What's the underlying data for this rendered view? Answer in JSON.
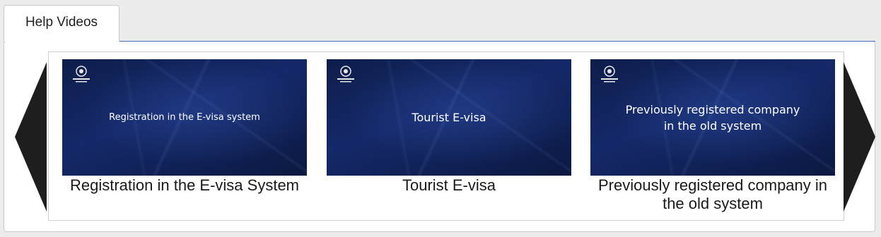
{
  "tabs": [
    {
      "label": "Help Videos",
      "active": true
    }
  ],
  "carousel": {
    "items": [
      {
        "thumbnail_text": "Registration in the E-visa system",
        "caption": "Registration in the E-visa System"
      },
      {
        "thumbnail_text": "Tourist E-visa",
        "caption": "Tourist E-visa"
      },
      {
        "thumbnail_text": "Previously registered company\nin the old system",
        "caption": "Previously registered company in the old system"
      }
    ],
    "prev_icon": "left-arrow-icon",
    "next_icon": "right-arrow-icon"
  },
  "colors": {
    "accent": "#3d6fb6",
    "arrow": "#1e1e1e",
    "thumbnail_bg": "#13275f"
  }
}
